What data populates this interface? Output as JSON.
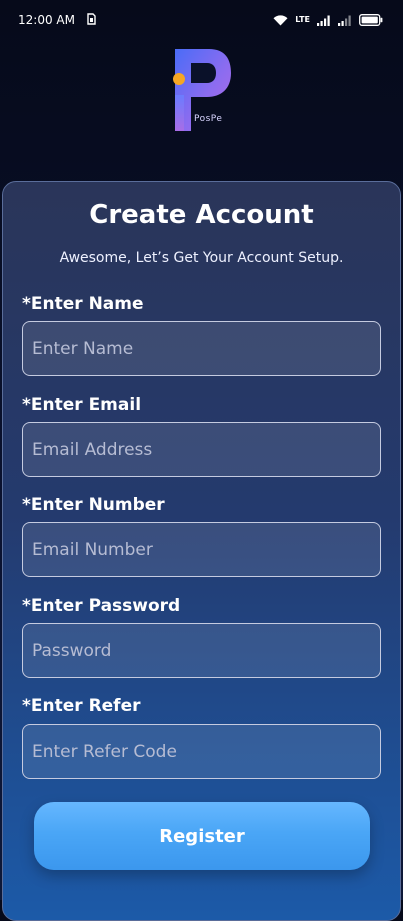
{
  "status_bar": {
    "time": "12:00 AM",
    "network_label": "LTE",
    "icons": [
      "sim-icon",
      "wifi-icon",
      "signal-icon",
      "signal-icon-2",
      "battery-icon"
    ]
  },
  "brand": {
    "logo_text": "PosPe",
    "colors": {
      "accent": "#4aa6f6",
      "logo_gradient_start": "#4a6cf7",
      "logo_gradient_end": "#b46ee8",
      "logo_dot": "#f5a623"
    }
  },
  "form": {
    "title": "Create Account",
    "subtitle": "Awesome, Let’s Get Your Account Setup.",
    "fields": [
      {
        "label": "*Enter Name",
        "placeholder": "Enter Name",
        "value": ""
      },
      {
        "label": "*Enter Email",
        "placeholder": "Email Address",
        "value": ""
      },
      {
        "label": "*Enter Number",
        "placeholder": "Email Number",
        "value": ""
      },
      {
        "label": "*Enter Password",
        "placeholder": "Password",
        "value": ""
      },
      {
        "label": "*Enter Refer",
        "placeholder": "Enter Refer Code",
        "value": ""
      }
    ],
    "submit_label": "Register"
  }
}
